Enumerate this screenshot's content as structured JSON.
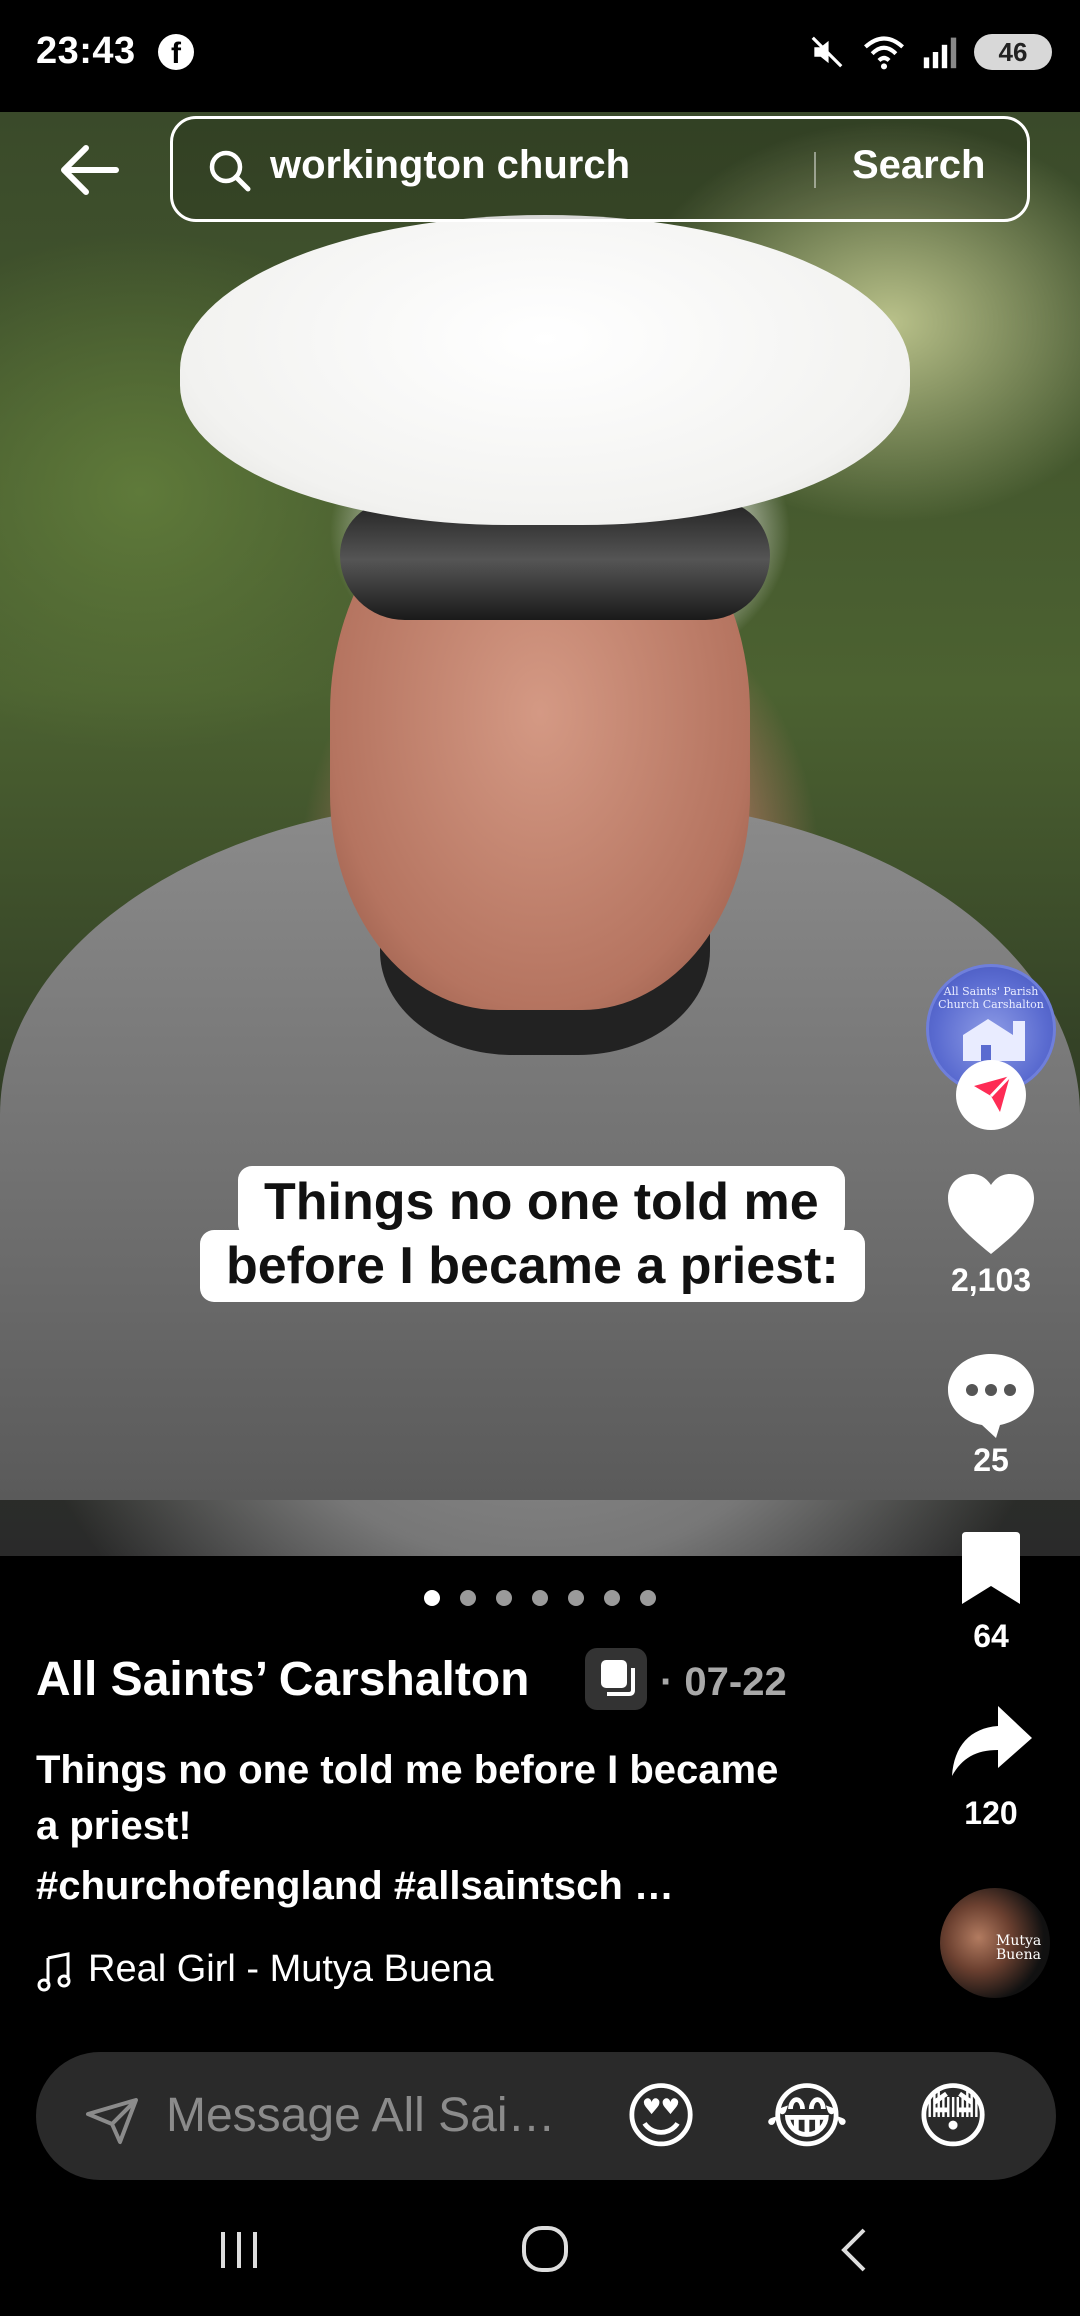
{
  "status_bar": {
    "time": "23:43",
    "facebook_icon": "f",
    "battery": "46",
    "network": "6"
  },
  "search": {
    "query": "workington church",
    "button_label": "Search"
  },
  "video": {
    "caption_line1": "Things no one told me",
    "caption_line2": "before I became a priest:",
    "page_dots": 7,
    "active_dot": 0
  },
  "actions": {
    "likes": "2,103",
    "comments": "25",
    "saves": "64",
    "shares": "120"
  },
  "post": {
    "author": "All Saints’ Carshalton",
    "date": "· 07-22",
    "description": "Things no one told me before I became a priest!",
    "hashtags": "#churchofengland #allsaintsch …",
    "music": "Real Girl - Mutya Buena"
  },
  "avatar_label": "All Saints' Parish Church Carshalton",
  "disc_label": "Mutya Buena",
  "message_bar": {
    "placeholder": "Message All Sai…",
    "emojis": [
      "😍",
      "😂",
      "😳"
    ]
  },
  "colors": {
    "background": "#000000",
    "accent_red": "#fe2c55",
    "message_bg": "#2a2a2a"
  }
}
